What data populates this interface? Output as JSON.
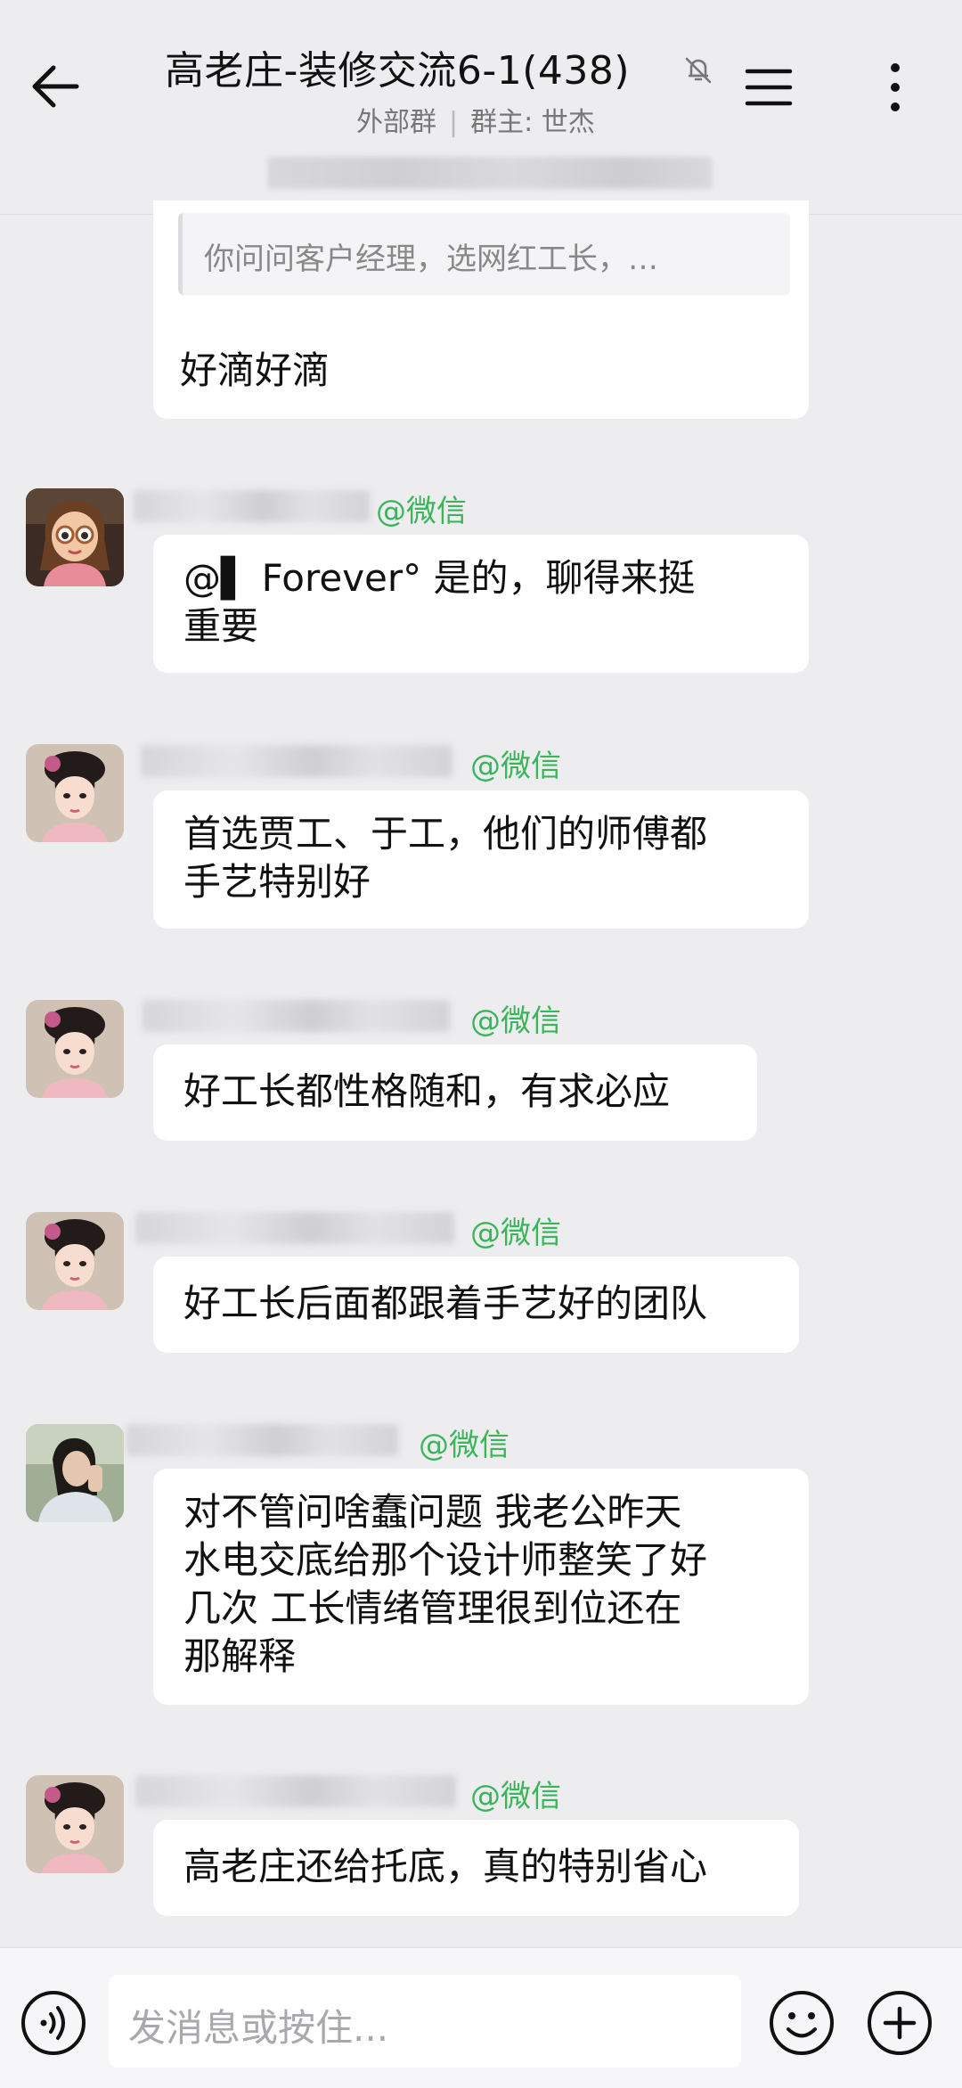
{
  "header": {
    "title": "高老庄-装修交流6-1(438)",
    "group_type": "外部群",
    "owner": "群主: 世杰"
  },
  "prev_message": {
    "quote": "你问问客户经理，选网红工长，…",
    "text": "好滴好滴"
  },
  "messages": [
    {
      "tag": "@微信",
      "text_lines": [
        "@▌  Forever°  是的，聊得来挺",
        "重要"
      ],
      "avatar": "cartoon-girl"
    },
    {
      "tag": "@微信",
      "text_lines": [
        "首选贾工、于工，他们的师傅都",
        "手艺特别好"
      ],
      "avatar": "qing-lady"
    },
    {
      "tag": "@微信",
      "text_lines": [
        "好工长都性格随和，有求必应"
      ],
      "avatar": "qing-lady"
    },
    {
      "tag": "@微信",
      "text_lines": [
        "好工长后面都跟着手艺好的团队"
      ],
      "avatar": "qing-lady"
    },
    {
      "tag": "@微信",
      "text_lines": [
        "对不管问啥蠢问题 我老公昨天",
        "水电交底给那个设计师整笑了好",
        "几次 工长情绪管理很到位还在",
        "那解释"
      ],
      "avatar": "photo-girl"
    },
    {
      "tag": "@微信",
      "text_lines": [
        "高老庄还给托底，真的特别省心"
      ],
      "avatar": "qing-lady"
    }
  ],
  "input": {
    "placeholder": "发消息或按住..."
  },
  "colors": {
    "background": "#ededf0",
    "bubble": "#ffffff",
    "tag_green": "#3bb55a"
  }
}
